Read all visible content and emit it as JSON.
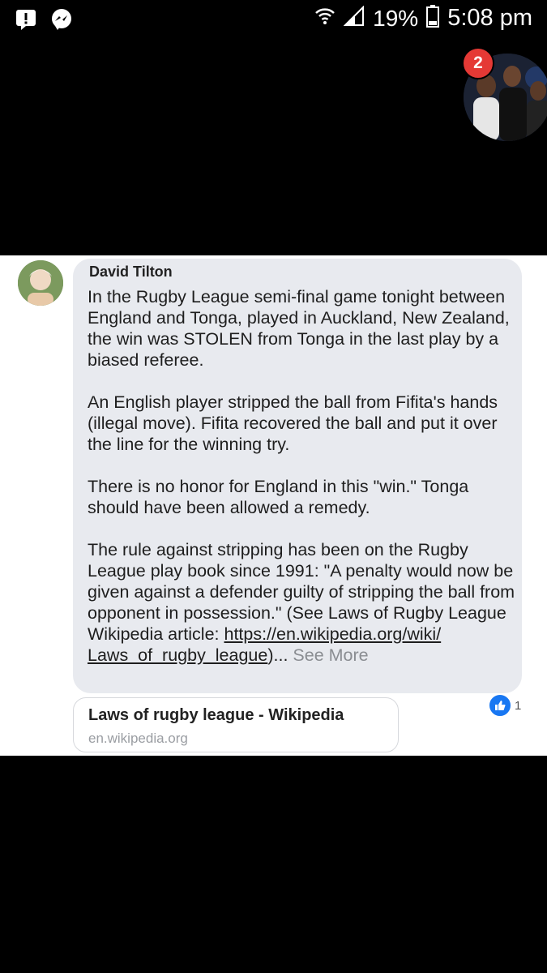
{
  "status_bar": {
    "battery_percent": "19%",
    "time": "5:08 pm",
    "icons": [
      "alert-icon",
      "messenger-icon",
      "wifi-icon",
      "signal-icon",
      "battery-icon"
    ]
  },
  "chat_head": {
    "badge_count": "2"
  },
  "post": {
    "author": "David Tilton",
    "paragraphs": [
      "In the Rugby League semi-final game tonight between England and Tonga, played in Auckland, New Zealand, the win was STOLEN from Tonga in the last play by a biased referee.",
      "An English player stripped the ball from Fifita's hands (illegal move). Fifita recovered the ball and put it over the line for the winning try.",
      "There is no honor for England in this \"win.\" Tonga should have been allowed a remedy."
    ],
    "last_paragraph_text": "The rule against stripping has been on the Rugby League play book since 1991: \"A penalty would now be given against a defender guilty of stripping the ball from opponent in possession.\" (See Laws of Rugby League Wikipedia article: ",
    "link_text": "https://en.wikipedia.org/wiki/ Laws_of_rugby_league",
    "after_link": ")",
    "ellipsis": "...",
    "see_more": "See More",
    "reaction_count": "1",
    "link_preview": {
      "title": "Laws of rugby league - Wikipedia",
      "domain": "en.wikipedia.org"
    }
  },
  "colors": {
    "background": "#000000",
    "bubble": "#e8eaef",
    "like_blue": "#1877f2",
    "badge_red": "#e53935"
  }
}
